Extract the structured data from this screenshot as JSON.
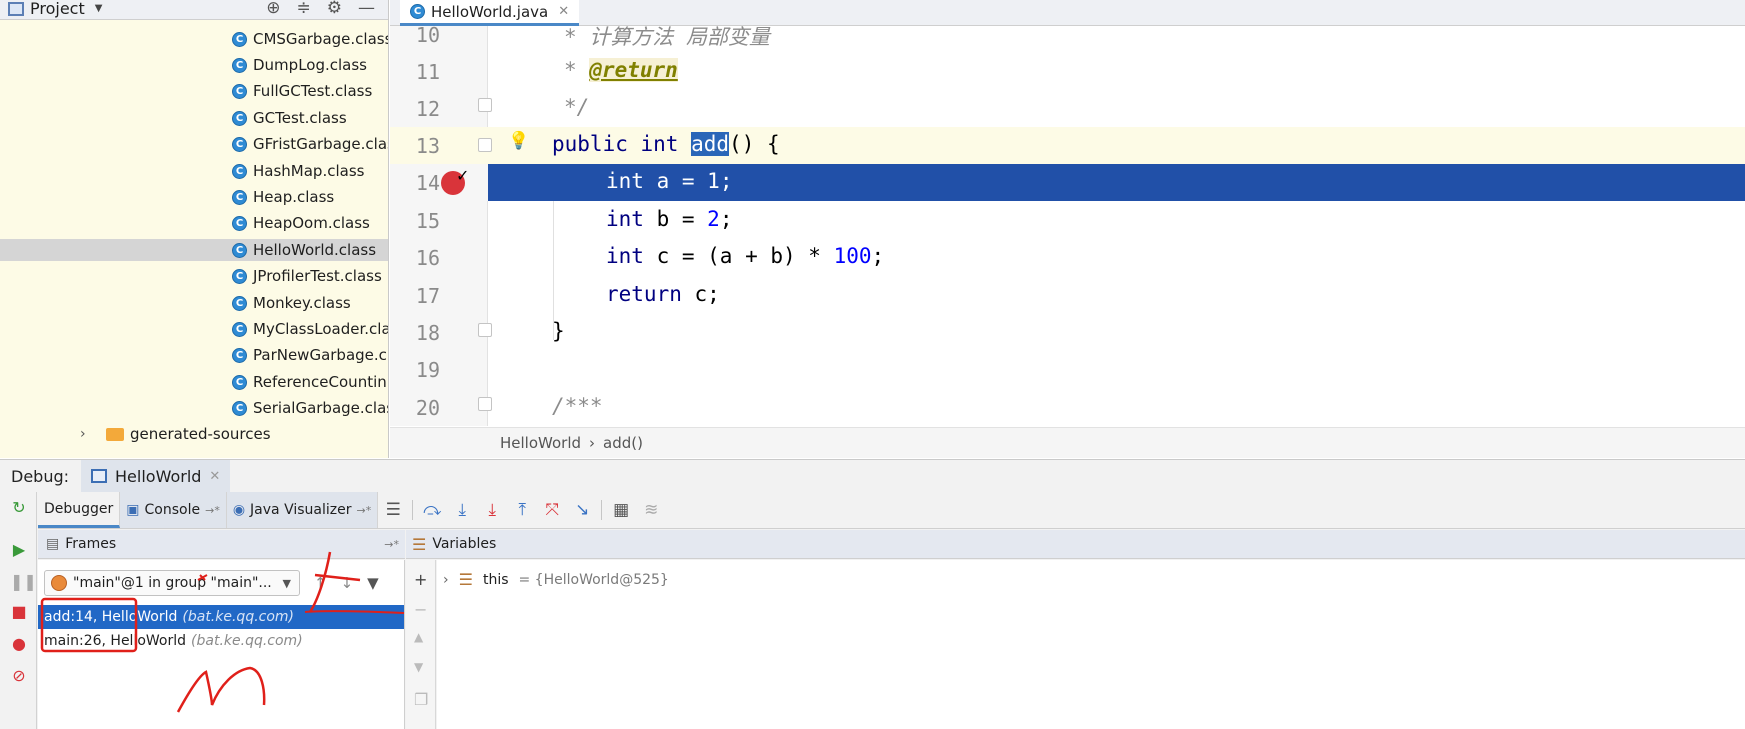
{
  "project": {
    "title": "Project",
    "items": [
      "CMSGarbage.class",
      "DumpLog.class",
      "FullGCTest.class",
      "GCTest.class",
      "GFristGarbage.clas",
      "HashMap.class",
      "Heap.class",
      "HeapOom.class",
      "HelloWorld.class",
      "JProfilerTest.class",
      "Monkey.class",
      "MyClassLoader.cla",
      "ParNewGarbage.cl",
      "ReferenceCountin",
      "SerialGarbage.clas"
    ],
    "folder": "generated-sources"
  },
  "editor": {
    "tab": "HelloWorld.java",
    "lines": {
      "l10": {
        "num": "10",
        "text": "* 计算方法 局部变量"
      },
      "l11": {
        "num": "11",
        "star": "* ",
        "tag": "@return"
      },
      "l12": {
        "num": "12",
        "text": "*/"
      },
      "l13": {
        "num": "13",
        "kw1": "public",
        "kw2": "int",
        "name": "add",
        "rest": "() {"
      },
      "l14": {
        "num": "14",
        "kw": "int",
        "pre": " a = ",
        "val": "1",
        "post": ";"
      },
      "l15": {
        "num": "15",
        "kw": "int",
        "pre": " b = ",
        "val": "2",
        "post": ";"
      },
      "l16": {
        "num": "16",
        "kw": "int",
        "pre": " c = (a + b) * ",
        "val": "100",
        "post": ";"
      },
      "l17": {
        "num": "17",
        "kw": "return",
        "pre": " c;"
      },
      "l18": {
        "num": "18",
        "text": "}"
      },
      "l19": {
        "num": "19"
      },
      "l20": {
        "num": "20",
        "text": "/***"
      }
    },
    "breadcrumb": {
      "cls": "HelloWorld",
      "method": "add()"
    }
  },
  "debug": {
    "label": "Debug:",
    "session": "HelloWorld",
    "tabs": {
      "debugger": "Debugger",
      "console": "Console",
      "visualizer": "Java Visualizer"
    },
    "frames_title": "Frames",
    "variables_title": "Variables",
    "thread": "\"main\"@1 in group \"main\"...",
    "frames": [
      {
        "loc": "add:14, HelloWorld",
        "pkg": "(bat.ke.qq.com)"
      },
      {
        "loc": "main:26, HelloWorld",
        "pkg": "(bat.ke.qq.com)"
      }
    ],
    "variable": {
      "name": "this",
      "value": "= {HelloWorld@525}"
    }
  },
  "colors": {
    "exec_line": "#2150a8",
    "selection": "#2168c6",
    "annotation": "#e0201a"
  }
}
